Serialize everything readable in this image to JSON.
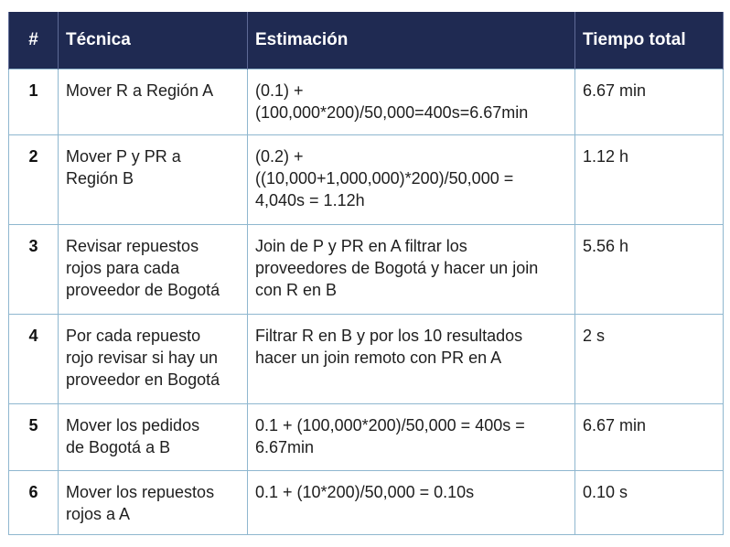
{
  "table": {
    "headers": {
      "num": "#",
      "tecnica": "Técnica",
      "estimacion": "Estimación",
      "tiempo": "Tiempo total"
    },
    "rows": [
      {
        "num": "1",
        "tecnica": "Mover R a Región A",
        "estimacion": "(0.1) +\n(100,000*200)/50,000=400s=6.67min",
        "tiempo": "6.67 min"
      },
      {
        "num": "2",
        "tecnica": "Mover P y PR a\nRegión B",
        "estimacion": "(0.2) +\n((10,000+1,000,000)*200)/50,000 =\n4,040s = 1.12h",
        "tiempo": "1.12 h"
      },
      {
        "num": "3",
        "tecnica": "Revisar repuestos\nrojos para cada\nproveedor de Bogotá",
        "estimacion": "Join de P y PR en A filtrar los\nproveedores de Bogotá y hacer un join\ncon R en B",
        "tiempo": "5.56 h"
      },
      {
        "num": "4",
        "tecnica": "Por cada repuesto\nrojo revisar si hay un\nproveedor en Bogotá",
        "estimacion": "Filtrar R en B y por los 10 resultados\nhacer un join remoto con PR en A",
        "tiempo": "2 s"
      },
      {
        "num": "5",
        "tecnica": "Mover los pedidos\nde Bogotá a B",
        "estimacion": "0.1 + (100,000*200)/50,000 = 400s =\n6.67min",
        "tiempo": "6.67 min"
      },
      {
        "num": "6",
        "tecnica": "Mover los repuestos\nrojos a A",
        "estimacion": "0.1 + (10*200)/50,000 = 0.10s",
        "tiempo": "0.10 s"
      }
    ]
  }
}
